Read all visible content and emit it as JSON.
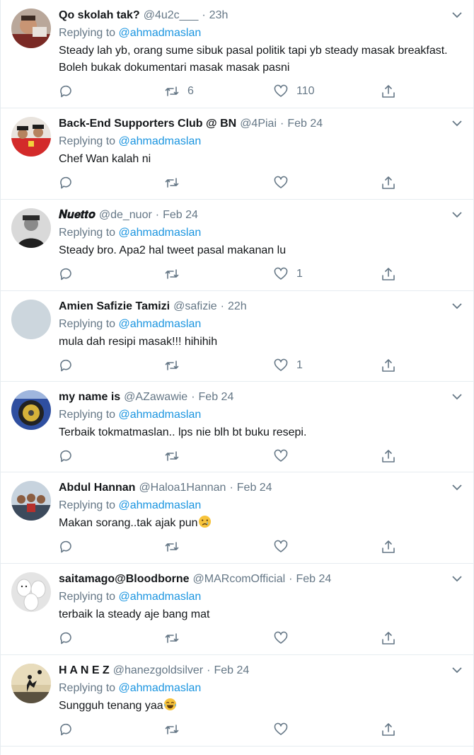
{
  "reply_prefix": "Replying to",
  "tweets": [
    {
      "name": "Qo skolah tak?",
      "handle": "@4u2c___",
      "time": "23h",
      "reply_to": "@ahmadmaslan",
      "text_lines": [
        "Steady lah yb, orang sume sibuk pasal politik tapi yb steady masak breakfast.",
        "Boleh bukak dokumentari masak masak pasni"
      ],
      "retweets": "6",
      "likes": "110",
      "avatar_icon": "avatar-red-jacket-man"
    },
    {
      "name": "Back-End Supporters Club @ BN",
      "handle": "@4Piai",
      "time": "Feb 24",
      "reply_to": "@ahmadmaslan",
      "text_lines": [
        "Chef Wan kalah ni"
      ],
      "retweets": "",
      "likes": "",
      "avatar_icon": "avatar-group-red"
    },
    {
      "name": "𝑵𝒖𝒆𝒕𝒕𝒐",
      "handle": "@de_nuor",
      "time": "Feb 24",
      "reply_to": "@ahmadmaslan",
      "text_lines": [
        "Steady bro. Apa2 hal tweet pasal makanan lu"
      ],
      "retweets": "",
      "likes": "1",
      "avatar_icon": "avatar-bw-man"
    },
    {
      "name": "Amien Safizie Tamizi",
      "handle": "@safizie",
      "time": "22h",
      "reply_to": "@ahmadmaslan",
      "text_lines": [
        "mula dah resipi masak!!! hihihih"
      ],
      "retweets": "",
      "likes": "1",
      "avatar_icon": "avatar-default-gray"
    },
    {
      "name": "my name is",
      "handle": "@AZawawie",
      "time": "Feb 24",
      "reply_to": "@ahmadmaslan",
      "text_lines": [
        "Terbaik tokmatmaslan.. lps nie blh bt buku resepi."
      ],
      "retweets": "",
      "likes": "",
      "avatar_icon": "avatar-car-wheel"
    },
    {
      "name": "Abdul Hannan",
      "handle": "@Haloa1Hannan",
      "time": "Feb 24",
      "reply_to": "@ahmadmaslan",
      "text_lines": [
        "Makan sorang..tak ajak pun"
      ],
      "emoji": "crying-face",
      "retweets": "",
      "likes": "",
      "avatar_icon": "avatar-group-outdoor"
    },
    {
      "name": "saitamago@Bloodborne",
      "handle": "@MARcomOfficial",
      "time": "Feb 24",
      "reply_to": "@ahmadmaslan",
      "text_lines": [
        "terbaik la steady aje bang mat"
      ],
      "retweets": "",
      "likes": "",
      "avatar_icon": "avatar-eggs"
    },
    {
      "name": "H A N E Z",
      "handle": "@hanezgoldsilver",
      "time": "Feb 24",
      "reply_to": "@ahmadmaslan",
      "text_lines": [
        "Sungguh tenang yaa"
      ],
      "emoji": "tears-of-joy",
      "retweets": "",
      "likes": "",
      "avatar_icon": "avatar-silhouette-sunset"
    }
  ],
  "colors": {
    "link": "#1b95e0",
    "muted": "#657786",
    "text": "#14171a",
    "divider": "#e6ecf0"
  }
}
